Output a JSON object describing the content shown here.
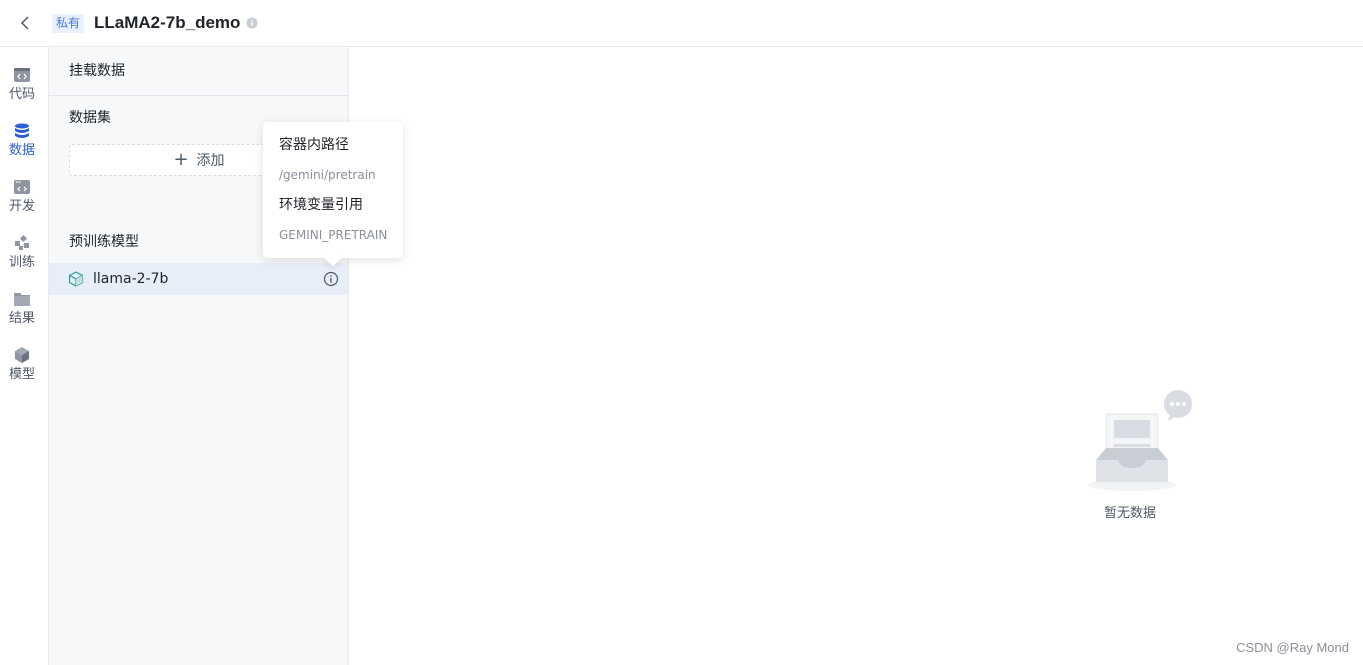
{
  "header": {
    "badge": "私有",
    "title": "LLaMA2-7b_demo"
  },
  "rail": {
    "items": [
      {
        "label": "代码",
        "icon": "code-window-icon"
      },
      {
        "label": "数据",
        "icon": "database-icon"
      },
      {
        "label": "开发",
        "icon": "dev-window-icon"
      },
      {
        "label": "训练",
        "icon": "training-nodes-icon"
      },
      {
        "label": "结果",
        "icon": "folder-icon"
      },
      {
        "label": "模型",
        "icon": "cube-icon"
      }
    ],
    "active": "数据"
  },
  "panel": {
    "title": "挂载数据",
    "dataset_title": "数据集",
    "add_label": "添加",
    "pretrain_title": "预训练模型",
    "model_name": "llama-2-7b"
  },
  "tooltip": {
    "path_label": "容器内路径",
    "path_value": "/gemini/pretrain",
    "env_label": "环境变量引用",
    "env_value": "GEMINI_PRETRAIN"
  },
  "main": {
    "empty_text": "暂无数据"
  },
  "watermark": "CSDN @Ray Mond",
  "colors": {
    "accent": "#2b5fd9",
    "selected_row": "#e8eef9",
    "panel_bg": "#f7f8fa"
  }
}
